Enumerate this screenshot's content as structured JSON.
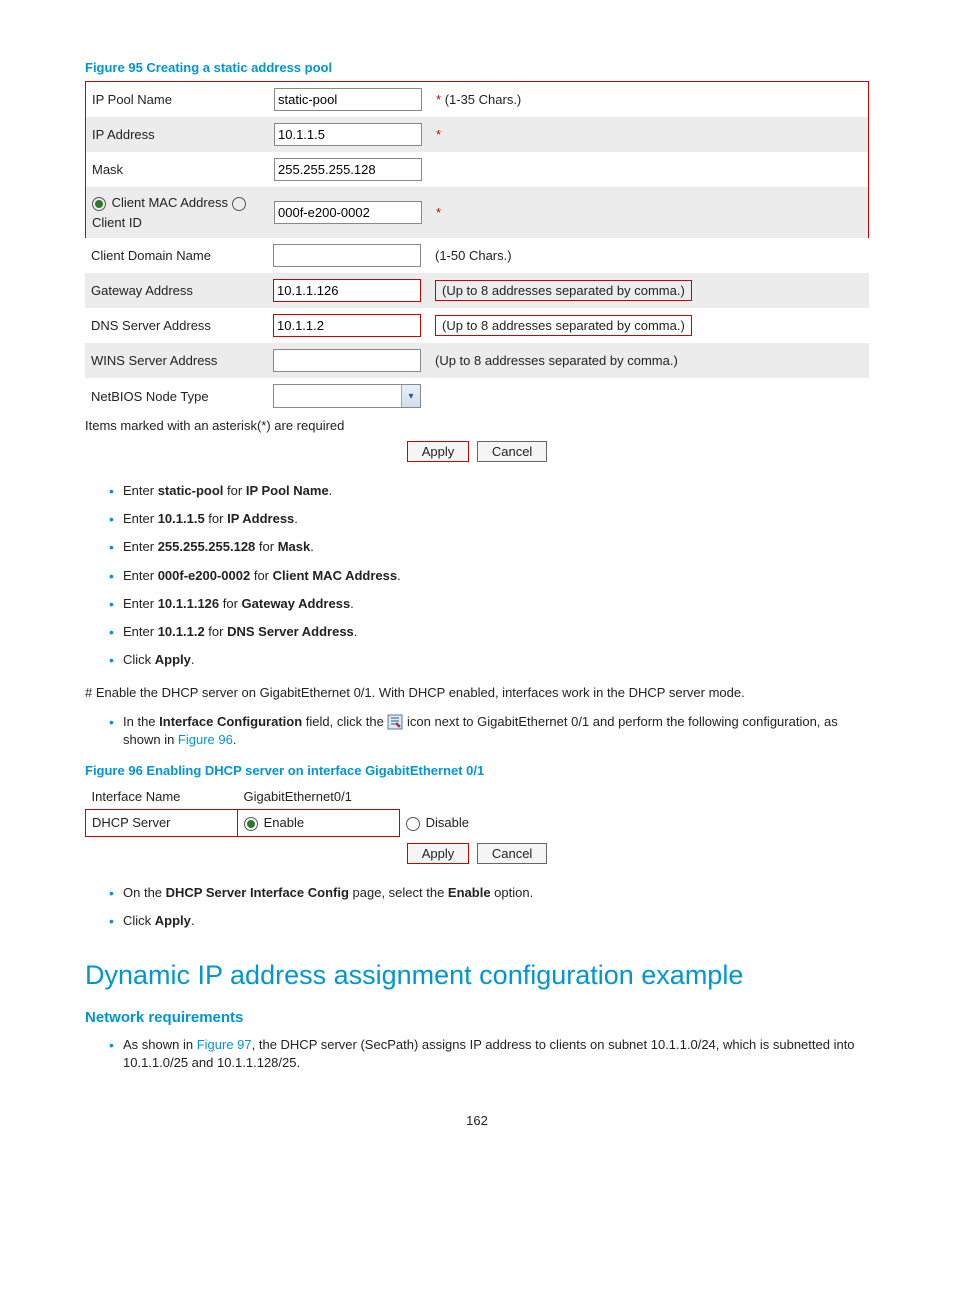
{
  "figure95": {
    "caption": "Figure 95 Creating a static address pool",
    "rows": {
      "ip_pool_name": {
        "label": "IP Pool Name",
        "value": "static-pool",
        "hint": "(1-35 Chars.)",
        "star": true
      },
      "ip_address": {
        "label": "IP Address",
        "value": "10.1.1.5",
        "star": true
      },
      "mask": {
        "label": "Mask",
        "value": "255.255.255.128"
      },
      "client_opt1": "Client MAC Address",
      "client_opt2": "Client ID",
      "client_value": "000f-e200-0002",
      "client_domain": {
        "label": "Client Domain Name",
        "value": "",
        "hint": "(1-50 Chars.)"
      },
      "gateway": {
        "label": "Gateway Address",
        "value": "10.1.1.126",
        "hint": "(Up to 8 addresses separated by comma.)"
      },
      "dns": {
        "label": "DNS Server Address",
        "value": "10.1.1.2",
        "hint": "(Up to 8 addresses separated by comma.)"
      },
      "wins": {
        "label": "WINS Server Address",
        "value": "",
        "hint": "(Up to 8 addresses separated by comma.)"
      },
      "netbios": {
        "label": "NetBIOS Node Type"
      }
    },
    "note": "Items marked with an asterisk(*) are required",
    "apply": "Apply",
    "cancel": "Cancel"
  },
  "bullets1": {
    "b1a": "Enter ",
    "b1b": "static-pool",
    "b1c": " for ",
    "b1d": "IP Pool Name",
    "b1e": ".",
    "b2a": "Enter ",
    "b2b": "10.1.1.5",
    "b2c": " for ",
    "b2d": "IP Address",
    "b2e": ".",
    "b3a": "Enter ",
    "b3b": "255.255.255.128",
    "b3c": " for ",
    "b3d": "Mask",
    "b3e": ".",
    "b4a": "Enter ",
    "b4b": "000f-e200-0002",
    "b4c": " for ",
    "b4d": "Client MAC Address",
    "b4e": ".",
    "b5a": "Enter ",
    "b5b": "10.1.1.126",
    "b5c": " for ",
    "b5d": "Gateway Address",
    "b5e": ".",
    "b6a": "Enter ",
    "b6b": "10.1.1.2",
    "b6c": " for ",
    "b6d": "DNS Server Address",
    "b6e": ".",
    "b7a": "Click ",
    "b7b": "Apply",
    "b7c": "."
  },
  "para1": "# Enable the DHCP server on GigabitEthernet 0/1. With DHCP enabled, interfaces work in the DHCP server mode.",
  "bullet_ic": {
    "a": "In the ",
    "b": "Interface Configuration",
    "c": " field, click the ",
    "d": " icon next to GigabitEthernet 0/1 and perform the following configuration, as shown in ",
    "link": "Figure 96",
    "e": "."
  },
  "figure96": {
    "caption": "Figure 96 Enabling DHCP server on interface GigabitEthernet 0/1",
    "iface_label": "Interface Name",
    "iface_value": "GigabitEthernet0/1",
    "dhcp_label": "DHCP Server",
    "enable": "Enable",
    "disable": "Disable",
    "apply": "Apply",
    "cancel": "Cancel"
  },
  "bullets2": {
    "b1a": "On the ",
    "b1b": "DHCP Server Interface Config",
    "b1c": " page, select the ",
    "b1d": "Enable",
    "b1e": " option.",
    "b2a": "Click ",
    "b2b": "Apply",
    "b2c": "."
  },
  "h1": "Dynamic IP address assignment configuration example",
  "h2": "Network requirements",
  "bullets3": {
    "a": "As shown in ",
    "link": "Figure 97",
    "b": ", the DHCP server (SecPath) assigns IP address to clients on subnet 10.1.1.0/24, which is subnetted into 10.1.1.0/25 and 10.1.1.128/25."
  },
  "page": "162"
}
